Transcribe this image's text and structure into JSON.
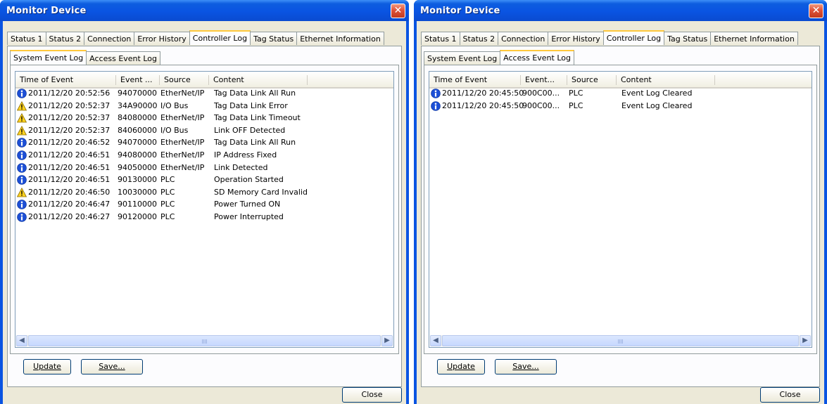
{
  "windows": [
    {
      "title": "Monitor Device",
      "tabs": [
        "Status 1",
        "Status 2",
        "Connection",
        "Error History",
        "Controller Log",
        "Tag Status",
        "Ethernet Information"
      ],
      "active_tab": "Controller Log",
      "subtabs": [
        "System Event Log",
        "Access Event Log"
      ],
      "active_subtab": "System Event Log",
      "columns": [
        "Time of Event",
        "Event ...",
        "Source",
        "Content"
      ],
      "rows": [
        {
          "icon": "info-icon",
          "time": "2011/12/20 20:52:56",
          "event": "94070000",
          "source": "EtherNet/IP",
          "content": "Tag Data Link All Run"
        },
        {
          "icon": "warning-icon",
          "time": "2011/12/20 20:52:37",
          "event": "34A90000",
          "source": "I/O Bus",
          "content": "Tag Data Link Error"
        },
        {
          "icon": "warning-icon",
          "time": "2011/12/20 20:52:37",
          "event": "84080000",
          "source": "EtherNet/IP",
          "content": "Tag Data Link Timeout"
        },
        {
          "icon": "warning-icon",
          "time": "2011/12/20 20:52:37",
          "event": "84060000",
          "source": "I/O Bus",
          "content": "Link OFF Detected"
        },
        {
          "icon": "info-icon",
          "time": "2011/12/20 20:46:52",
          "event": "94070000",
          "source": "EtherNet/IP",
          "content": "Tag Data Link All Run"
        },
        {
          "icon": "info-icon",
          "time": "2011/12/20 20:46:51",
          "event": "94080000",
          "source": "EtherNet/IP",
          "content": "IP Address Fixed"
        },
        {
          "icon": "info-icon",
          "time": "2011/12/20 20:46:51",
          "event": "94050000",
          "source": "EtherNet/IP",
          "content": "Link Detected"
        },
        {
          "icon": "info-icon",
          "time": "2011/12/20 20:46:51",
          "event": "90130000",
          "source": "PLC",
          "content": "Operation Started"
        },
        {
          "icon": "warning-icon",
          "time": "2011/12/20 20:46:50",
          "event": "10030000",
          "source": "PLC",
          "content": "SD Memory Card Invalid"
        },
        {
          "icon": "info-icon",
          "time": "2011/12/20 20:46:47",
          "event": "90110000",
          "source": "PLC",
          "content": "Power Turned ON"
        },
        {
          "icon": "info-icon",
          "time": "2011/12/20 20:46:27",
          "event": "90120000",
          "source": "PLC",
          "content": "Power Interrupted"
        }
      ],
      "buttons": {
        "update": "Update",
        "save": "Save...",
        "close": "Close"
      }
    },
    {
      "title": "Monitor Device",
      "tabs": [
        "Status 1",
        "Status 2",
        "Connection",
        "Error History",
        "Controller Log",
        "Tag Status",
        "Ethernet Information"
      ],
      "active_tab": "Controller Log",
      "subtabs": [
        "System Event Log",
        "Access Event Log"
      ],
      "active_subtab": "Access Event Log",
      "columns": [
        "Time of Event",
        "Event...",
        "Source",
        "Content"
      ],
      "rows": [
        {
          "icon": "info-icon",
          "time": "2011/12/20 20:45:50",
          "event": "900C00...",
          "source": "PLC",
          "content": "Event Log Cleared"
        },
        {
          "icon": "info-icon",
          "time": "2011/12/20 20:45:50",
          "event": "900C00...",
          "source": "PLC",
          "content": "Event Log Cleared"
        }
      ],
      "buttons": {
        "update": "Update",
        "save": "Save...",
        "close": "Close"
      }
    }
  ],
  "colors": {
    "titlebar": "#0a54e2",
    "face": "#ece9d8",
    "tab_highlight": "#ffc83c",
    "info_icon": "#1c4fd6",
    "warning_icon": "#ffd21f",
    "close_button": "#e0533a"
  }
}
